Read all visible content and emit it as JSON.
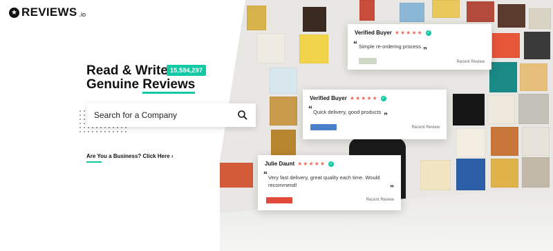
{
  "brand": {
    "name": "REVIEWS",
    "suffix": ".io",
    "star_glyph": "★",
    "accent": "#12c9a3"
  },
  "hero": {
    "line1": "Read & Write",
    "line2_a": "Genuine ",
    "line2_b": "Reviews",
    "counter": "15,584,297"
  },
  "search": {
    "placeholder": "Search for a Company",
    "icon": "search-icon"
  },
  "business_link": "Are You a Business? Click Here",
  "business_chevron": "›",
  "reviews": [
    {
      "name": "Verified Buyer",
      "stars": "★★★★★",
      "quote_open": "“",
      "quote_close": "”",
      "text": "Simple re-ordering process",
      "label": "Recent Review"
    },
    {
      "name": "Verified Buyer",
      "stars": "★★★★★",
      "quote_open": "“",
      "quote_close": "”",
      "text": "Quick delivery, good products",
      "label": "Recent Review"
    },
    {
      "name": "Julie Daunt",
      "stars": "★★★★★",
      "quote_open": "“",
      "quote_close": "”",
      "text": "Very fast delivery, great quality each time. Would recommend!",
      "label": "Recent Review"
    }
  ],
  "colors": {
    "star": "#f26a5a",
    "verified": "#12c9a3"
  }
}
